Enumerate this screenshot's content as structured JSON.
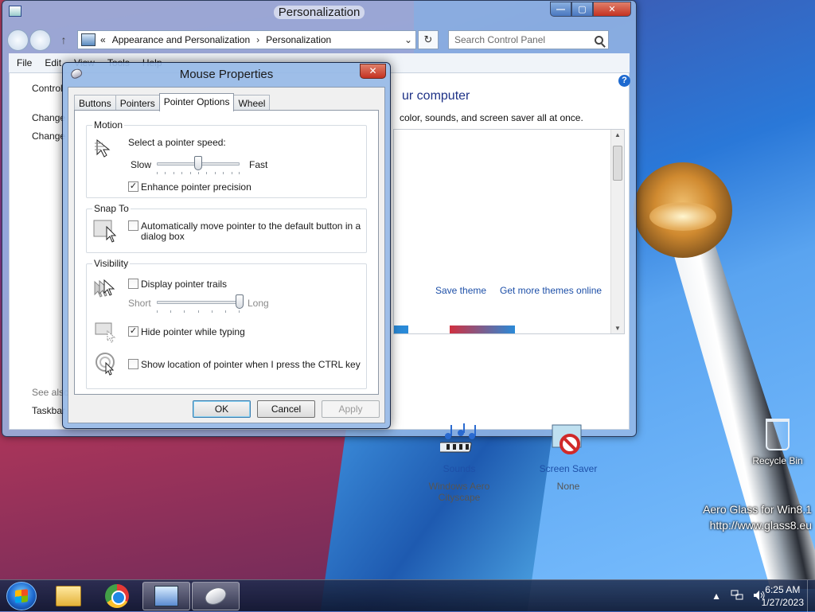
{
  "control_panel": {
    "title": "Personalization",
    "address": {
      "prefix": "«",
      "crumb1": "Appearance and Personalization",
      "separator": "›",
      "crumb2": "Personalization"
    },
    "search_placeholder": "Search Control Panel",
    "menu": [
      "File",
      "Edit",
      "View",
      "Tools",
      "Help"
    ],
    "sidebar": {
      "home": "Control",
      "link1": "Change",
      "link2": "Change",
      "see_also": "See also",
      "taskbar": "Taskbar"
    },
    "heading": "ur computer",
    "description": "color, sounds, and screen saver all at once.",
    "save_theme": "Save theme",
    "get_more_themes": "Get more themes online",
    "sounds_label": "Sounds",
    "sounds_value": "Windows Aero Cityscape",
    "screensaver_label": "Screen Saver",
    "screensaver_value": "None"
  },
  "mouse_dialog": {
    "title": "Mouse Properties",
    "tabs": [
      "Buttons",
      "Pointers",
      "Pointer Options",
      "Wheel"
    ],
    "active_tab": "Pointer Options",
    "motion": {
      "group": "Motion",
      "speed_label": "Select a pointer speed:",
      "slow": "Slow",
      "fast": "Fast",
      "speed_level": 0.5,
      "enhance_label": "Enhance pointer precision",
      "enhance_checked": true
    },
    "snap_to": {
      "group": "Snap To",
      "label_line1": "Automatically move pointer to the default button in a",
      "label_line2": "dialog box",
      "checked": false
    },
    "visibility": {
      "group": "Visibility",
      "trails_label": "Display pointer trails",
      "trails_checked": false,
      "short": "Short",
      "long": "Long",
      "trail_level": 1.0,
      "hide_label": "Hide pointer while typing",
      "hide_checked": true,
      "ctrl_label": "Show location of pointer when I press the CTRL key",
      "ctrl_checked": false
    },
    "buttons": {
      "ok": "OK",
      "cancel": "Cancel",
      "apply": "Apply"
    }
  },
  "desktop": {
    "recycle_bin": "Recycle Bin",
    "watermark_line1": "Aero Glass for Win8.1",
    "watermark_line2": "http://www.glass8.eu"
  },
  "taskbar": {
    "time": "6:25 AM",
    "date": "1/27/2023",
    "tray_up": "▲"
  }
}
